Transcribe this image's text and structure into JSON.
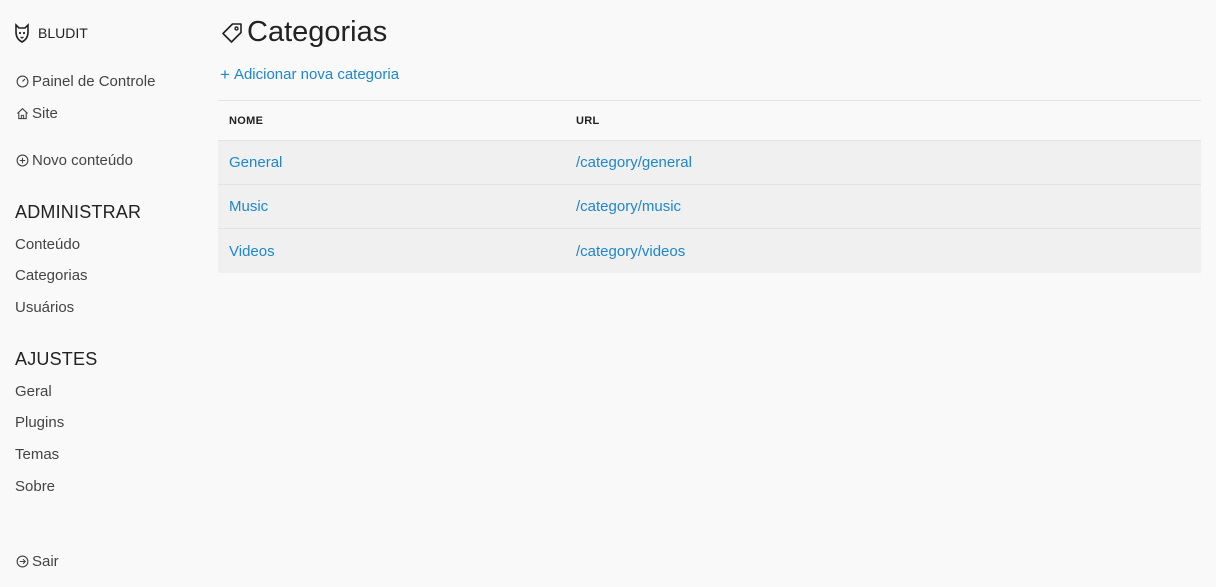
{
  "brand": {
    "name": "BLUDIT"
  },
  "sidebar": {
    "dashboard": "Painel de Controle",
    "site": "Site",
    "new_content": "Novo conteúdo",
    "admin_title": "ADMINISTRAR",
    "admin_items": [
      "Conteúdo",
      "Categorias",
      "Usuários"
    ],
    "settings_title": "AJUSTES",
    "settings_items": [
      "Geral",
      "Plugins",
      "Temas",
      "Sobre"
    ],
    "logout": "Sair"
  },
  "main": {
    "title": "Categorias",
    "add_label": "Adicionar nova categoria",
    "add_icon": "+",
    "columns": [
      "NOME",
      "URL"
    ],
    "rows": [
      {
        "name": "General",
        "url": "/category/general"
      },
      {
        "name": "Music",
        "url": "/category/music"
      },
      {
        "name": "Videos",
        "url": "/category/videos"
      }
    ]
  },
  "colors": {
    "link": "#1e87c8",
    "background": "#f9f9f9",
    "row_background": "#f0f0f0"
  }
}
